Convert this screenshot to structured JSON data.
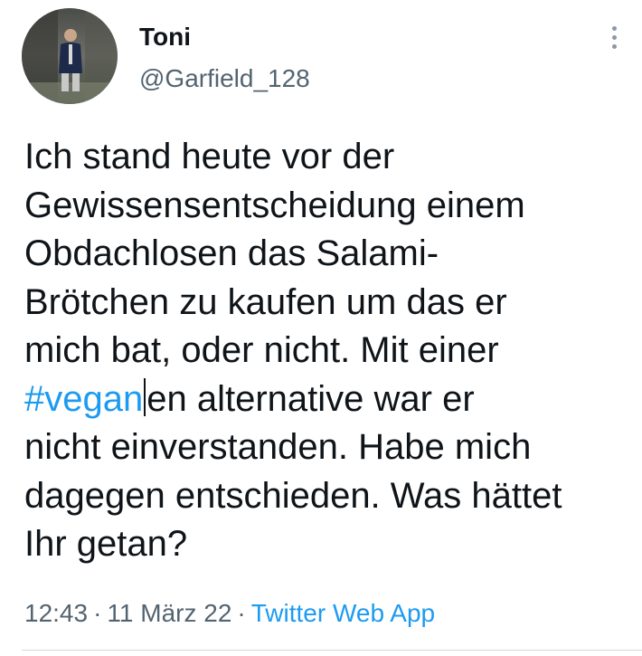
{
  "author": {
    "display_name": "Toni",
    "handle": "@Garfield_128",
    "avatar_icon": "profile-photo"
  },
  "more_icon": "more-vertical-icon",
  "tweet": {
    "text_part1": "Ich stand heute vor der\nGewissensentscheidung einem\nObdachlosen das Salami-\nBrötchen zu kaufen um das er\nmich bat, oder nicht. Mit einer\n",
    "hashtag": "#vegan",
    "text_part2": "en alternative war er\nnicht einverstanden. Habe mich\ndagegen entschieden. Was hättet\nIhr getan?"
  },
  "meta": {
    "time": "12:43",
    "separator": "·",
    "date": "11 März 22",
    "source": "Twitter Web App"
  },
  "colors": {
    "text": "#0f1419",
    "secondary": "#536471",
    "link": "#1d9bf0",
    "divider": "#cfd9de"
  }
}
